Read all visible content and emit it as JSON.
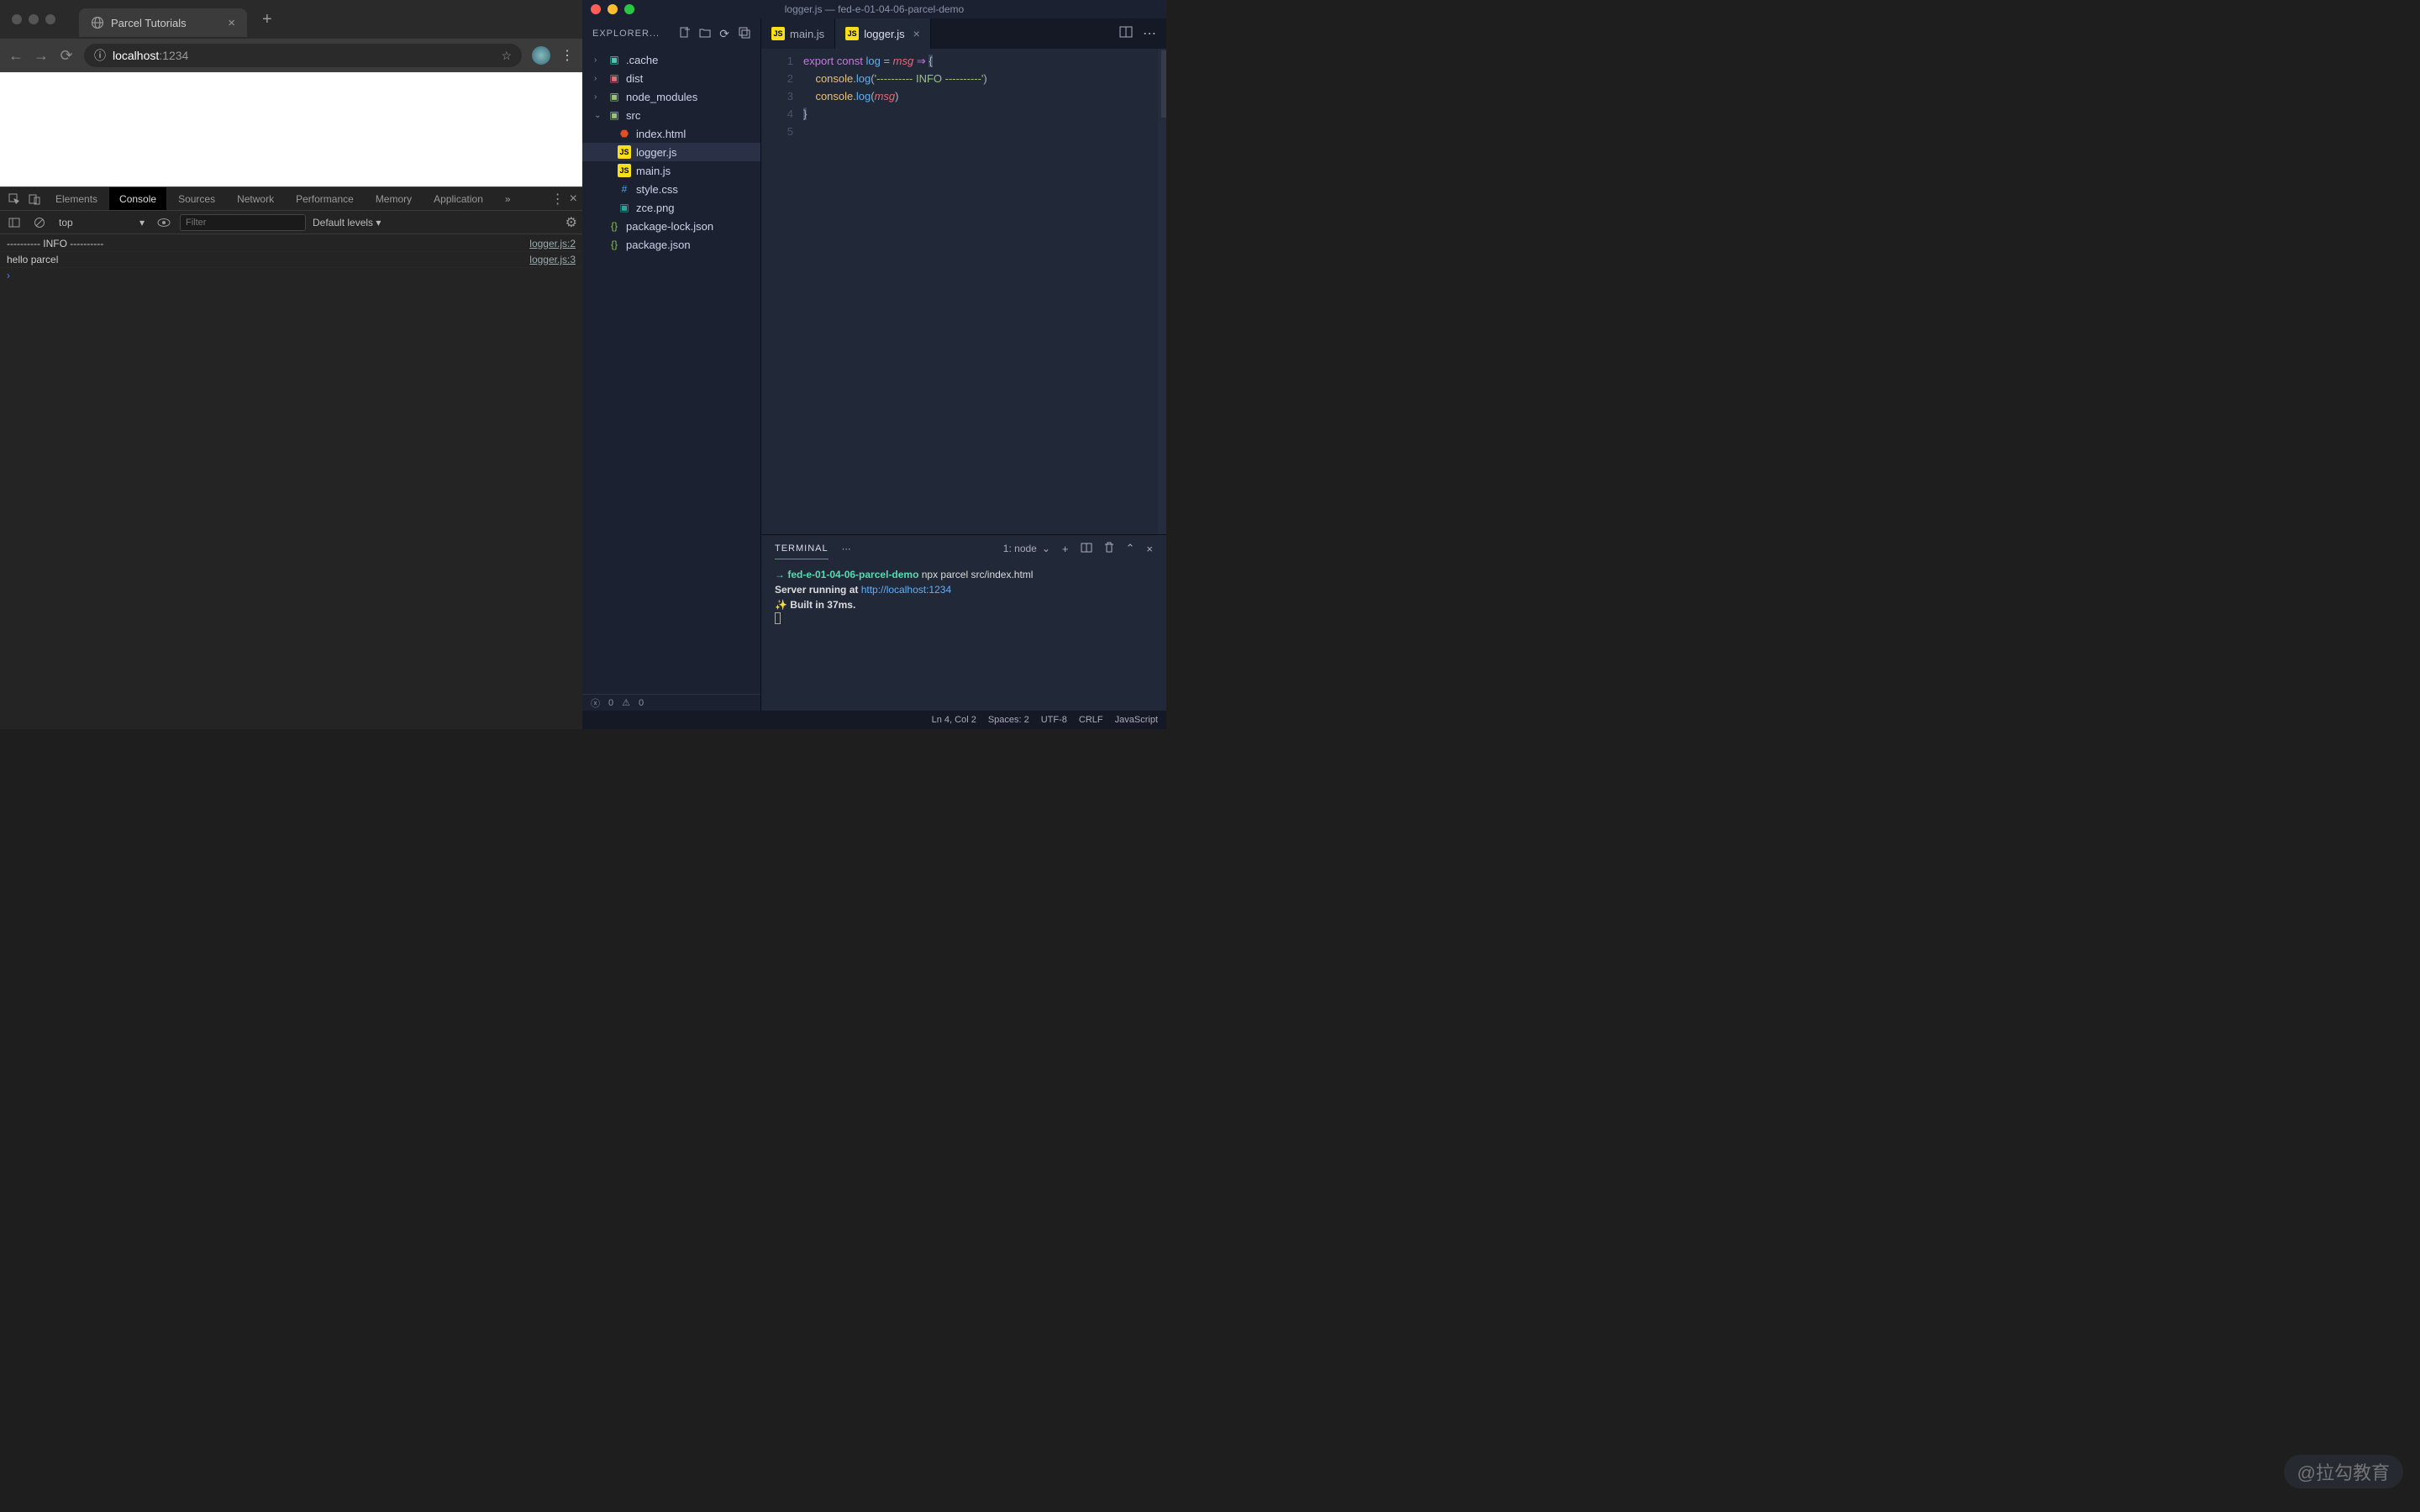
{
  "browser": {
    "tab_title": "Parcel Tutorials",
    "address_host": "localhost",
    "address_port": ":1234",
    "devtools": {
      "tabs": [
        "Elements",
        "Console",
        "Sources",
        "Network",
        "Performance",
        "Memory",
        "Application"
      ],
      "active_tab": "Console",
      "context": "top",
      "filter_placeholder": "Filter",
      "levels": "Default levels",
      "console_lines": [
        {
          "text": "---------- INFO ----------",
          "source": "logger.js:2"
        },
        {
          "text": "hello parcel",
          "source": "logger.js:3"
        }
      ]
    }
  },
  "vscode": {
    "window_title": "logger.js — fed-e-01-04-06-parcel-demo",
    "explorer_label": "EXPLORER...",
    "tree": {
      "folders": [
        {
          "name": ".cache",
          "expanded": false,
          "iconClass": "folder-cache"
        },
        {
          "name": "dist",
          "expanded": false,
          "iconClass": "folder-red"
        },
        {
          "name": "node_modules",
          "expanded": false,
          "iconClass": "folder-green"
        },
        {
          "name": "src",
          "expanded": true,
          "iconClass": "folder-green"
        }
      ],
      "src_files": [
        {
          "name": "index.html",
          "iconClass": "html",
          "iconText": "⬢"
        },
        {
          "name": "logger.js",
          "iconClass": "js",
          "iconText": "JS",
          "selected": true
        },
        {
          "name": "main.js",
          "iconClass": "js",
          "iconText": "JS"
        },
        {
          "name": "style.css",
          "iconClass": "css",
          "iconText": "#"
        },
        {
          "name": "zce.png",
          "iconClass": "img",
          "iconText": "▣"
        }
      ],
      "root_files": [
        {
          "name": "package-lock.json",
          "iconClass": "json",
          "iconText": "{}"
        },
        {
          "name": "package.json",
          "iconClass": "json",
          "iconText": "{}"
        }
      ]
    },
    "sidebar_bottom": {
      "errors": "0",
      "warnings": "0"
    },
    "editor_tabs": [
      {
        "name": "main.js",
        "iconClass": "js",
        "iconText": "JS",
        "active": false
      },
      {
        "name": "logger.js",
        "iconClass": "js",
        "iconText": "JS",
        "active": true
      }
    ],
    "code": {
      "lines": [
        1,
        2,
        3,
        4,
        5
      ],
      "content": {
        "l1": {
          "export": "export",
          "const": "const",
          "log": "log",
          "eq": " = ",
          "msg": "msg",
          "arrow": " ⇒ ",
          "brace": "{"
        },
        "l2": {
          "indent": "    ",
          "console": "console",
          "dot": ".",
          "logfn": "log",
          "open": "(",
          "str": "'---------- INFO ----------'",
          "close": ")"
        },
        "l3": {
          "indent": "    ",
          "console": "console",
          "dot": ".",
          "logfn": "log",
          "open": "(",
          "msg": "msg",
          "close": ")"
        },
        "l4": {
          "brace": "}"
        }
      }
    },
    "terminal": {
      "tab_label": "TERMINAL",
      "dropdown": "1: node",
      "lines": {
        "prompt_arrow": "→",
        "path": "fed-e-01-04-06-parcel-demo",
        "command": "npx parcel src/index.html",
        "server_text": "Server running at ",
        "server_url": "http://localhost:1234",
        "spark": "✨",
        "built_text": "  Built in 37ms."
      }
    },
    "statusbar": {
      "position": "Ln 4, Col 2",
      "spaces": "Spaces: 2",
      "encoding": "UTF-8",
      "eol": "CRLF",
      "lang": "JavaScript"
    }
  },
  "watermark": "@拉勾教育"
}
